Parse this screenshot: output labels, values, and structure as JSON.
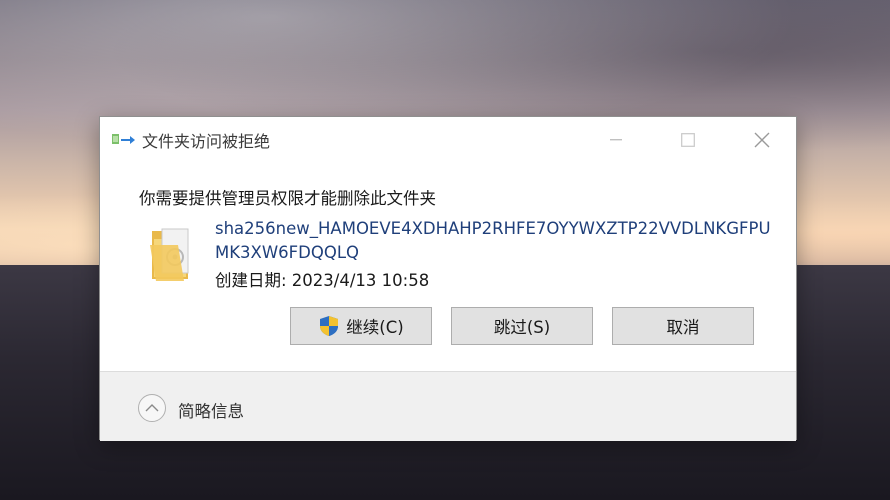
{
  "dialog": {
    "title": "文件夹访问被拒绝",
    "message": "你需要提供管理员权限才能删除此文件夹",
    "file_name": "sha256new_HAMOEVE4XDHAHP2RHFE7OYYWXZTP22VVDLNKGFPUMK3XW6FDQQLQ",
    "created": "创建日期: 2023/4/13 10:58",
    "buttons": {
      "continue": "继续(C)",
      "skip": "跳过(S)",
      "cancel": "取消"
    },
    "footer": {
      "toggle_label": "简略信息"
    }
  },
  "icons": {
    "title": "folder-move-icon",
    "file": "folder-icon",
    "uac": "uac-shield-icon",
    "footer": "chevron-up-icon"
  },
  "colors": {
    "dialog_bg": "#ffffff",
    "filename_text": "#1f3f7a",
    "button_bg": "#e1e1e1",
    "footer_bg": "#f0f0f0"
  }
}
